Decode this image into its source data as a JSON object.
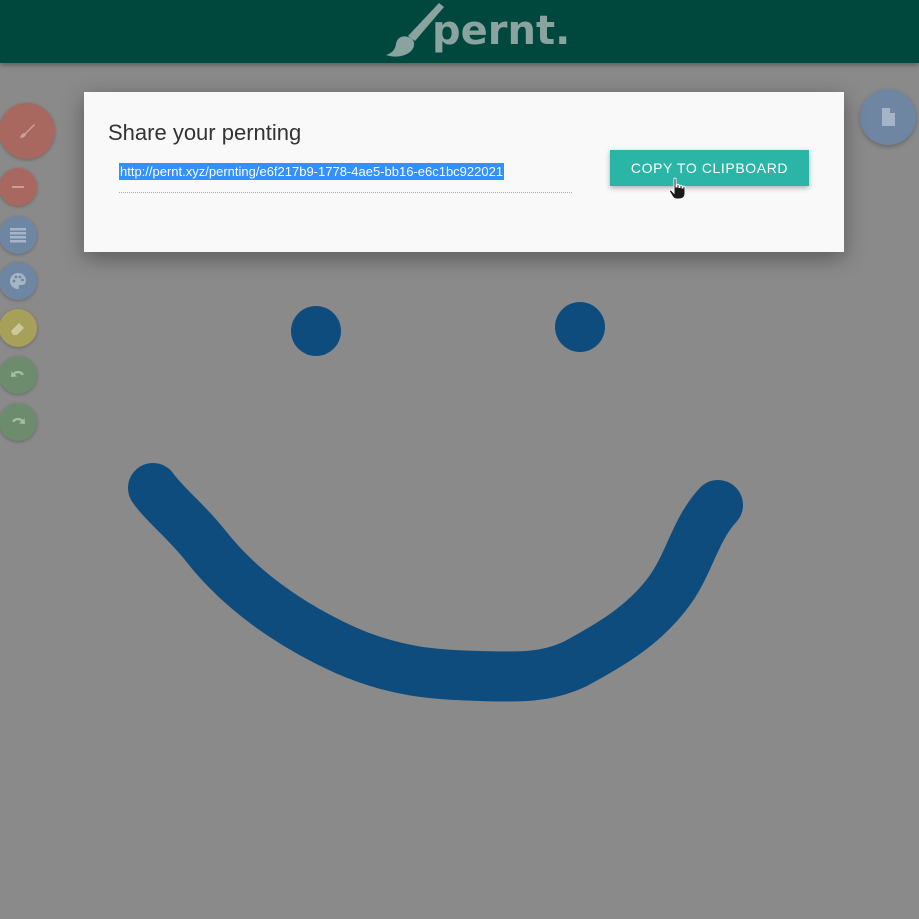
{
  "header": {
    "logo_text": "pernt."
  },
  "toolbar": {
    "tools": [
      {
        "name": "brush-tool",
        "icon": "brush-icon",
        "color": "#a86860"
      },
      {
        "name": "minus-tool",
        "icon": "minus-icon",
        "color": "#a86860"
      },
      {
        "name": "size-tool",
        "icon": "lines-icon",
        "color": "#6f86a3"
      },
      {
        "name": "color-tool",
        "icon": "palette-icon",
        "color": "#6f86a3"
      },
      {
        "name": "eraser-tool",
        "icon": "eraser-icon",
        "color": "#a7a05a"
      },
      {
        "name": "undo-tool",
        "icon": "undo-icon",
        "color": "#6d8c6d"
      },
      {
        "name": "redo-tool",
        "icon": "redo-icon",
        "color": "#6d8c6d"
      }
    ]
  },
  "file_button": {
    "icon": "file-icon"
  },
  "modal": {
    "title": "Share your pernting",
    "link": "http://pernt.xyz/pernting/e6f217b9-1778-4ae5-bb16-e6c1bc922021",
    "copy_label": "COPY TO CLIPBOARD"
  },
  "drawing": {
    "stroke_color": "#0f4c7e"
  }
}
